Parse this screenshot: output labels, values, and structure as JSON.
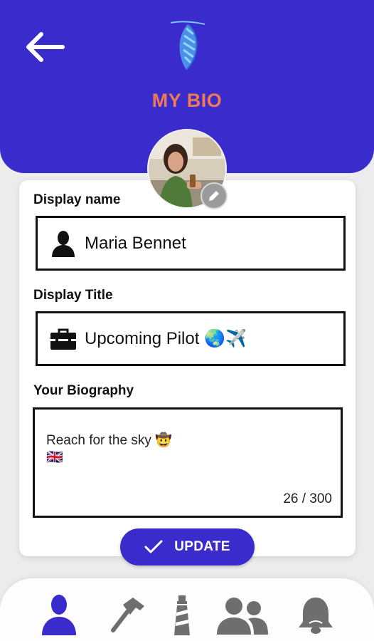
{
  "header": {
    "title": "MY BIO",
    "back_icon": "arrow-left-icon",
    "logo_icon": "feather-leaf-logo"
  },
  "profile": {
    "avatar_icon": "profile-photo",
    "edit_icon": "pencil-icon"
  },
  "form": {
    "display_name": {
      "label": "Display name",
      "value": "Maria Bennet",
      "icon": "user-silhouette-icon"
    },
    "display_title": {
      "label": "Display Title",
      "value": "Upcoming Pilot 🌏✈️",
      "icon": "toolbox-icon"
    },
    "biography": {
      "label": "Your Biography",
      "value": "Reach for the sky 🤠\n🇬🇧",
      "counter": "26 / 300"
    }
  },
  "actions": {
    "update_label": "UPDATE",
    "update_icon": "check-icon"
  },
  "nav": {
    "items": [
      {
        "name": "profile",
        "icon": "person-icon",
        "active": true
      },
      {
        "name": "tools",
        "icon": "hammer-icon",
        "active": false
      },
      {
        "name": "lighthouse",
        "icon": "lighthouse-icon",
        "active": false
      },
      {
        "name": "group",
        "icon": "group-icon",
        "active": false
      },
      {
        "name": "notifications",
        "icon": "bell-icon",
        "active": false
      }
    ]
  },
  "colors": {
    "primary": "#3a2ccc",
    "title": "#f07a54",
    "inactive": "#6e6e6e"
  }
}
